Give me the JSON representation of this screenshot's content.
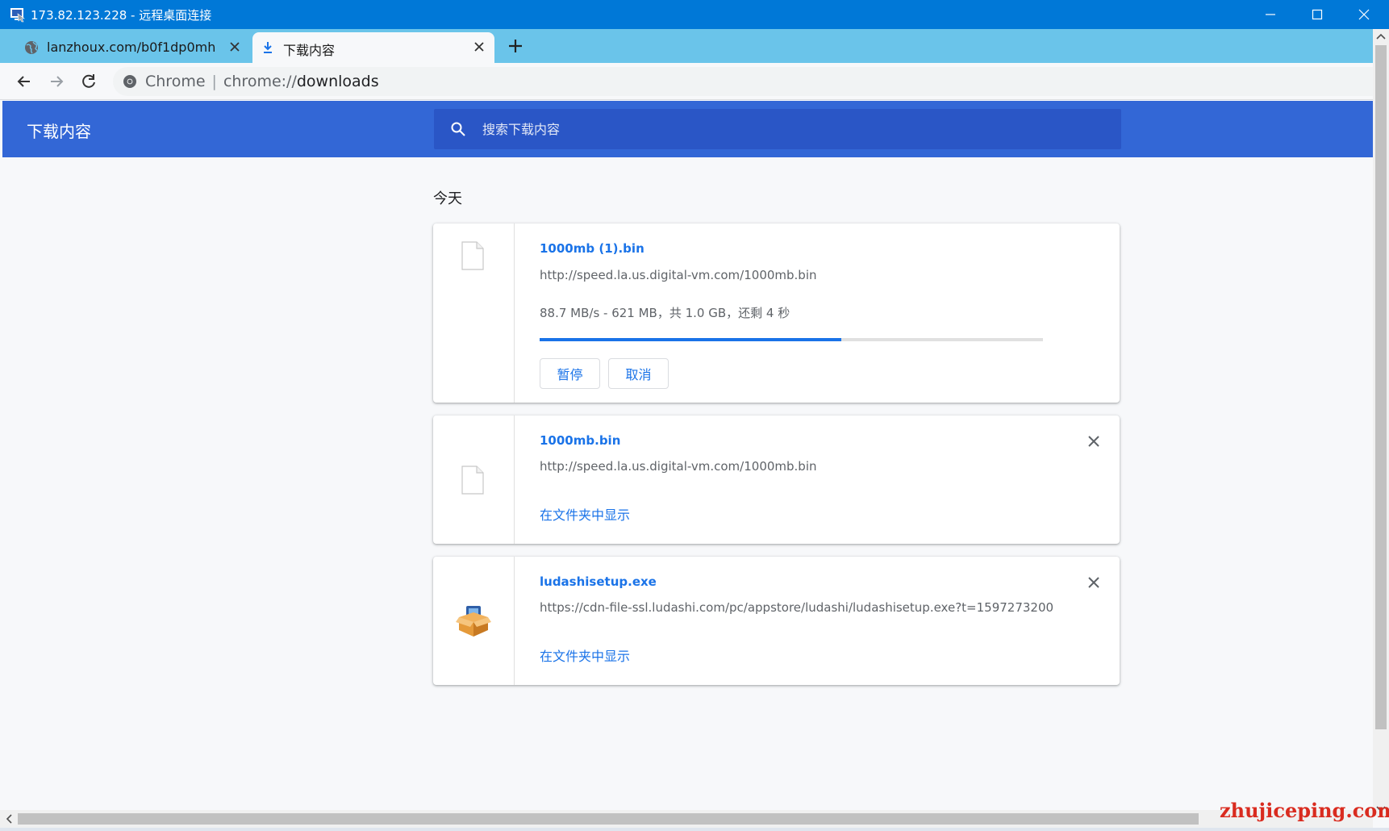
{
  "rdp": {
    "title": "173.82.123.228 - 远程桌面连接"
  },
  "tabs": [
    {
      "label": "lanzhoux.com/b0f1dp0mh",
      "active": false,
      "icon": "globe-icon"
    },
    {
      "label": "下载内容",
      "active": true,
      "icon": "download-icon"
    }
  ],
  "toolbar": {
    "omnibox_origin": "Chrome",
    "omnibox_scheme": "chrome://",
    "omnibox_path": "downloads"
  },
  "header": {
    "title": "下载内容",
    "search_placeholder": "搜索下载内容"
  },
  "main": {
    "date_label": "今天",
    "downloads": [
      {
        "name": "1000mb (1).bin",
        "url": "http://speed.la.us.digital-vm.com/1000mb.bin",
        "status": "88.7 MB/s - 621 MB，共 1.0 GB，还剩 4 秒",
        "progress_fraction": 0.6,
        "buttons": {
          "pause": "暂停",
          "cancel": "取消"
        },
        "icon": "file-icon"
      },
      {
        "name": "1000mb.bin",
        "url": "http://speed.la.us.digital-vm.com/1000mb.bin",
        "link": "在文件夹中显示",
        "icon": "file-icon"
      },
      {
        "name": "ludashisetup.exe",
        "url": "https://cdn-file-ssl.ludashi.com/pc/appstore/ludashi/ludashisetup.exe?t=1597273200",
        "link": "在文件夹中显示",
        "icon": "installer-box-icon"
      }
    ]
  },
  "watermark": "zhujiceping.com",
  "colors": {
    "accent": "#1a73e8",
    "header": "#3367d6",
    "rdp_bar": "#0078d7",
    "tabstrip": "#6ac4ea"
  }
}
